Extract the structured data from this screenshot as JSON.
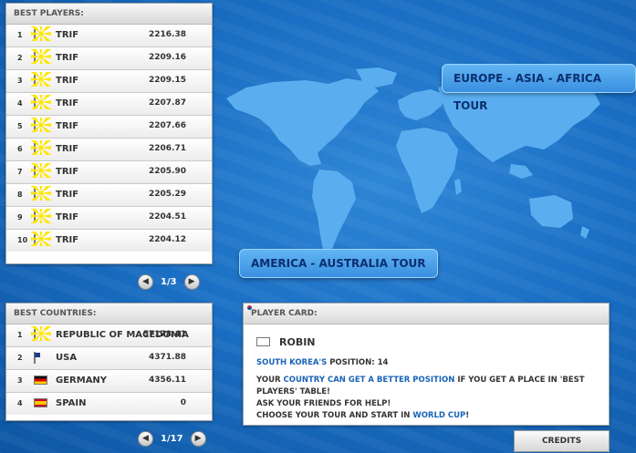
{
  "best_players": {
    "title": "BEST PLAYERS:",
    "rows": [
      {
        "rank": "1",
        "name": "TRIF",
        "score": "2216.38"
      },
      {
        "rank": "2",
        "name": "TRIF",
        "score": "2209.16"
      },
      {
        "rank": "3",
        "name": "TRIF",
        "score": "2209.15"
      },
      {
        "rank": "4",
        "name": "TRIF",
        "score": "2207.87"
      },
      {
        "rank": "5",
        "name": "TRIF",
        "score": "2207.66"
      },
      {
        "rank": "6",
        "name": "TRIF",
        "score": "2206.71"
      },
      {
        "rank": "7",
        "name": "TRIF",
        "score": "2205.90"
      },
      {
        "rank": "8",
        "name": "TRIF",
        "score": "2205.29"
      },
      {
        "rank": "9",
        "name": "TRIF",
        "score": "2204.51"
      },
      {
        "rank": "10",
        "name": "TRIF",
        "score": "2204.12"
      }
    ],
    "page": "1/3"
  },
  "best_countries": {
    "title": "BEST COUNTRIES:",
    "rows": [
      {
        "rank": "1",
        "flag": "mk",
        "name": "REPUBLIC OF MACEDONIA",
        "score": "57178.41"
      },
      {
        "rank": "2",
        "flag": "us",
        "name": "USA",
        "score": "4371.88"
      },
      {
        "rank": "3",
        "flag": "de",
        "name": "GERMANY",
        "score": "4356.11"
      },
      {
        "rank": "4",
        "flag": "es",
        "name": "SPAIN",
        "score": "0"
      }
    ],
    "page": "1/17"
  },
  "tours": {
    "europe": "EUROPE - ASIA - AFRICA TOUR",
    "america": "AMERICA - AUSTRALIA TOUR"
  },
  "player_card": {
    "title": "PLAYER CARD:",
    "name": "ROBIN",
    "country": "SOUTH KOREA'S",
    "position_label": "POSITION: 14",
    "line1_a": "YOUR ",
    "line1_b": "COUNTRY CAN GET A BETTER POSITION",
    "line1_c": " IF YOU GET A PLACE IN 'BEST PLAYERS' TABLE!",
    "line2": "ASK YOUR FRIENDS FOR HELP!",
    "line3_a": "CHOOSE YOUR TOUR AND START IN ",
    "line3_b": "WORLD CUP",
    "line3_c": "!"
  },
  "credits": "CREDITS",
  "icons": {
    "prev": "arrow-left-icon",
    "next": "arrow-right-icon"
  },
  "colors": {
    "background": "#1a6fc4",
    "map": "#5aaeef",
    "tour_button": "#4aa0ea",
    "highlight": "#1a63b8"
  }
}
